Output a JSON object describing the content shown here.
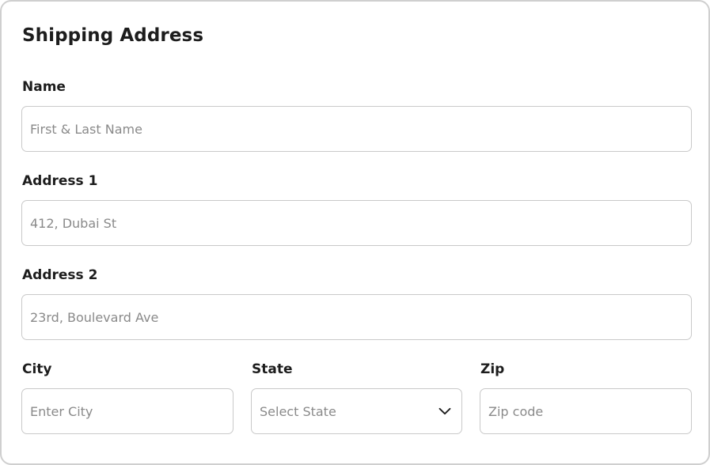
{
  "form": {
    "title": "Shipping Address",
    "name": {
      "label": "Name",
      "placeholder": "First & Last Name",
      "value": ""
    },
    "address1": {
      "label": "Address 1",
      "placeholder": "412, Dubai St",
      "value": ""
    },
    "address2": {
      "label": "Address 2",
      "placeholder": "23rd, Boulevard Ave",
      "value": ""
    },
    "city": {
      "label": "City",
      "placeholder": "Enter City",
      "value": ""
    },
    "state": {
      "label": "State",
      "selected": "Select State",
      "icon": "chevron-down-icon"
    },
    "zip": {
      "label": "Zip",
      "placeholder": "Zip code",
      "value": ""
    }
  },
  "colors": {
    "border": "#c9c9c9",
    "placeholder": "#8a8a8a",
    "text": "#1d1d1d"
  }
}
